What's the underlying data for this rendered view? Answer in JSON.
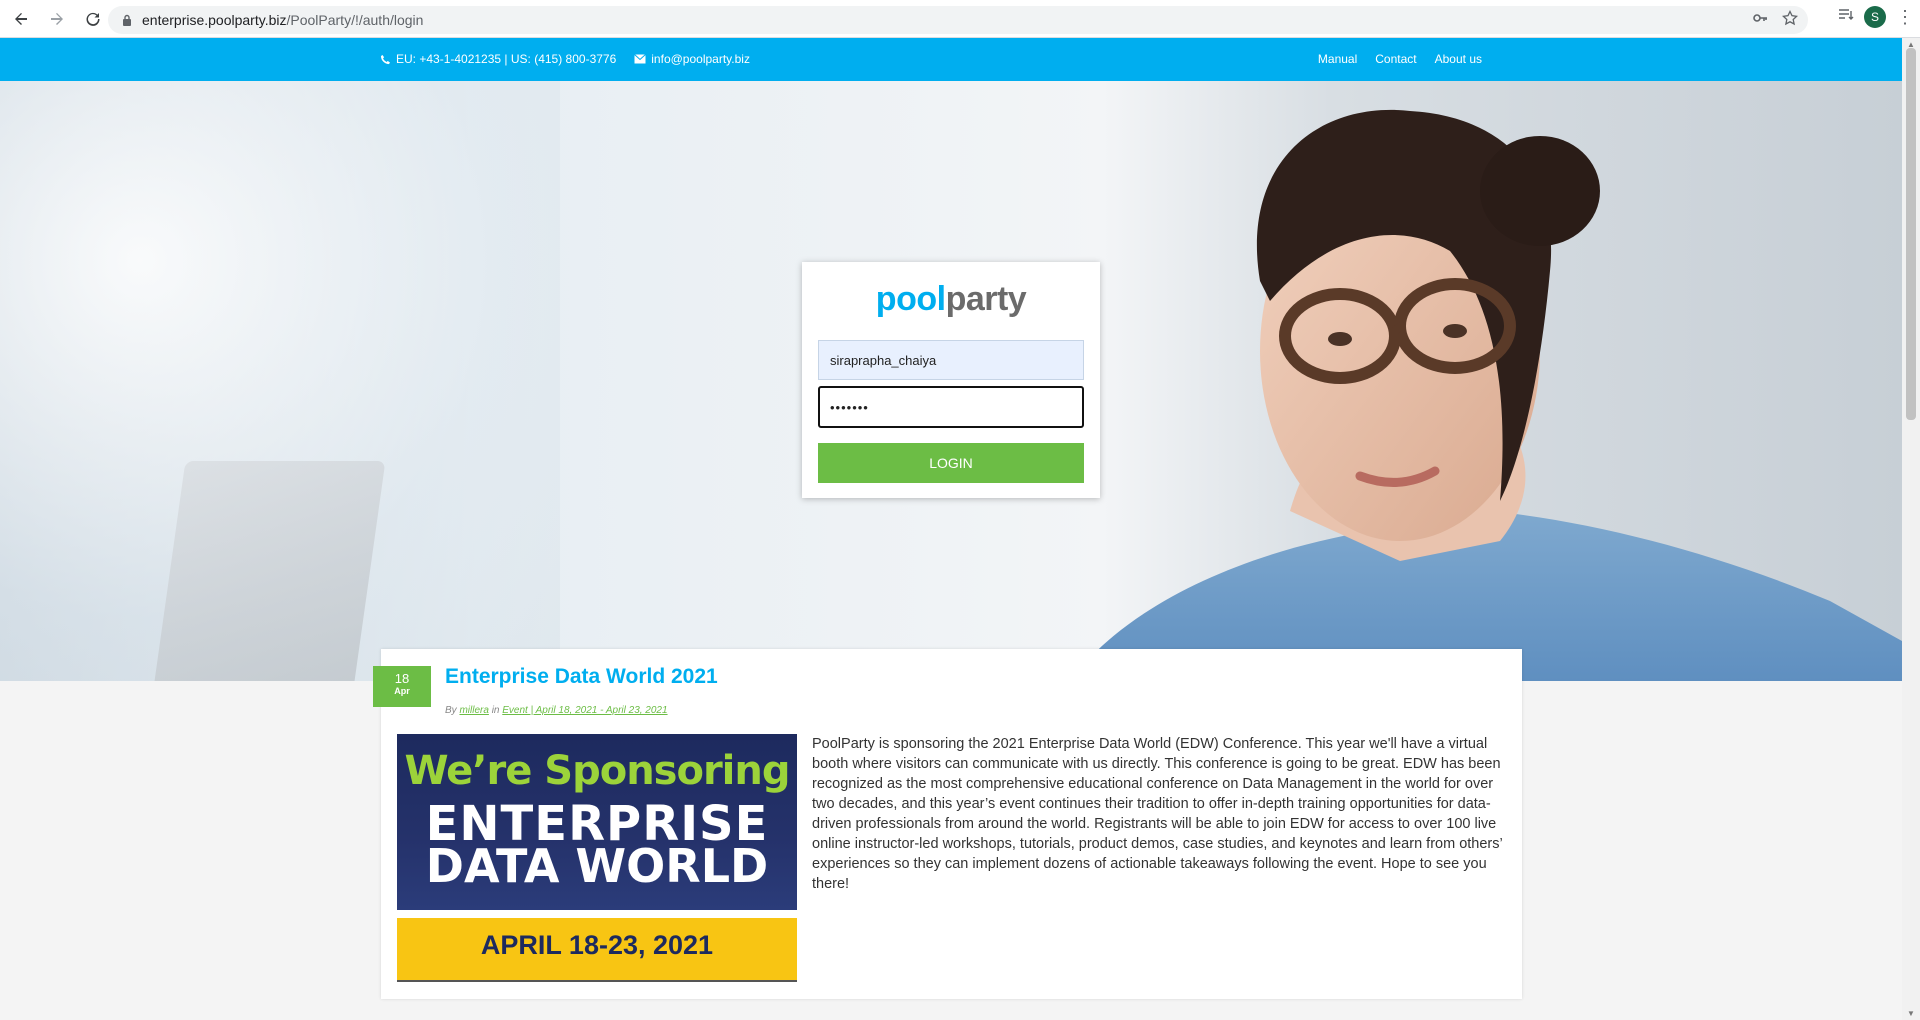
{
  "browser": {
    "url_host": "enterprise.poolparty.biz",
    "url_path": "/PoolParty/!/auth/login",
    "profile_initial": "S"
  },
  "topbar": {
    "phone": "EU: +43-1-4021235 | US: (415) 800-3776",
    "email": "info@poolparty.biz",
    "menu": [
      "Manual",
      "Contact",
      "About us"
    ]
  },
  "login": {
    "logo_pool": "pool",
    "logo_party": "party",
    "username_value": "siraprapha_chaiya",
    "password_value": "•••••••",
    "button_label": "LOGIN"
  },
  "article": {
    "day": "18",
    "month": "Apr",
    "title": "Enterprise Data World 2021",
    "meta_by": "By",
    "meta_author": "millera",
    "meta_in": "in",
    "meta_category": "Event | April 18, 2021 - April 23, 2021",
    "banner_line1": "We’re Sponsoring",
    "banner_line2": "ENTERPRISE",
    "banner_line3": "DATA WORLD",
    "banner_dates": "APRIL 18-23, 2021",
    "body": "PoolParty is sponsoring the 2021 Enterprise Data World (EDW) Conference. This year we'll have a virtual booth where visitors can communicate with us directly. This conference is going to be great. EDW has been recognized as the most comprehensive educational conference on Data Management in the world for over two decades, and this year’s event continues their tradition to offer in-depth training opportunities for data-driven professionals from around the world. Registrants will be able to join EDW for access to over 100 live online instructor-led workshops, tutorials, product demos, case studies, and keynotes and learn from others’ experiences so they can implement dozens of actionable takeaways following the event. Hope to see you there!"
  },
  "colors": {
    "brand_blue": "#00aeef",
    "brand_green": "#6cbd45",
    "banner_navy": "#1d2a5e",
    "banner_yellow": "#f8c513"
  }
}
